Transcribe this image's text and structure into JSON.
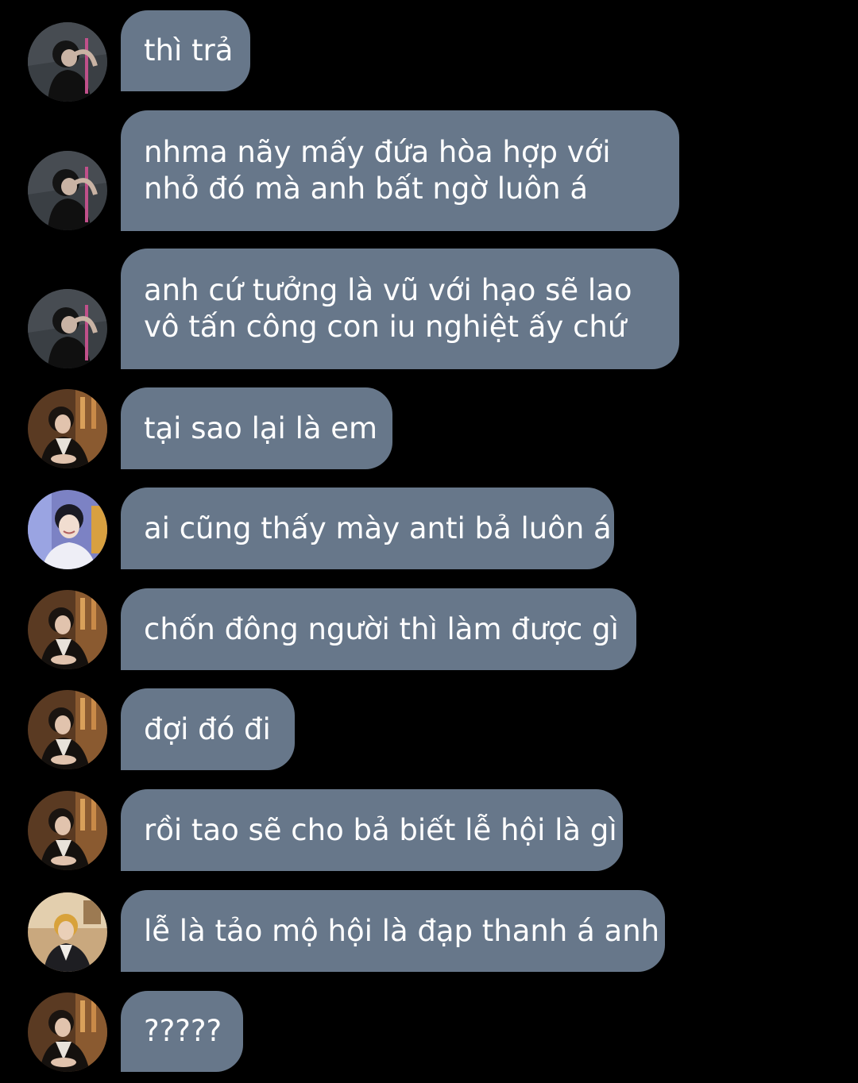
{
  "conversation": {
    "messages": [
      {
        "sender": "avatar-dark-hoodie",
        "lines": [
          "thì trả"
        ]
      },
      {
        "sender": "avatar-dark-hoodie",
        "lines": [
          "nhma nãy mấy đứa hòa hợp với",
          "nhỏ đó mà anh bất ngờ luôn á"
        ]
      },
      {
        "sender": "avatar-dark-hoodie",
        "lines": [
          "anh cứ tưởng là vũ với hạo sẽ lao",
          "vô tấn công con iu nghiệt ấy chứ"
        ]
      },
      {
        "sender": "avatar-warm-bar",
        "lines": [
          "tại sao lại là em"
        ]
      },
      {
        "sender": "avatar-blue-smile",
        "lines": [
          "ai cũng thấy mày anti bả luôn á"
        ]
      },
      {
        "sender": "avatar-warm-bar",
        "lines": [
          "chốn đông người thì làm được gì"
        ]
      },
      {
        "sender": "avatar-warm-bar",
        "lines": [
          "đợi đó đi"
        ]
      },
      {
        "sender": "avatar-warm-bar",
        "lines": [
          "rồi tao sẽ cho bả biết lễ hội là gì"
        ]
      },
      {
        "sender": "avatar-cafe-jacket",
        "lines": [
          "lễ là tảo mộ hội là đạp thanh á anh"
        ]
      },
      {
        "sender": "avatar-warm-bar",
        "lines": [
          "?????"
        ]
      }
    ]
  },
  "colors": {
    "background": "#000000",
    "bubble": "#67778a",
    "text": "#ffffff"
  }
}
